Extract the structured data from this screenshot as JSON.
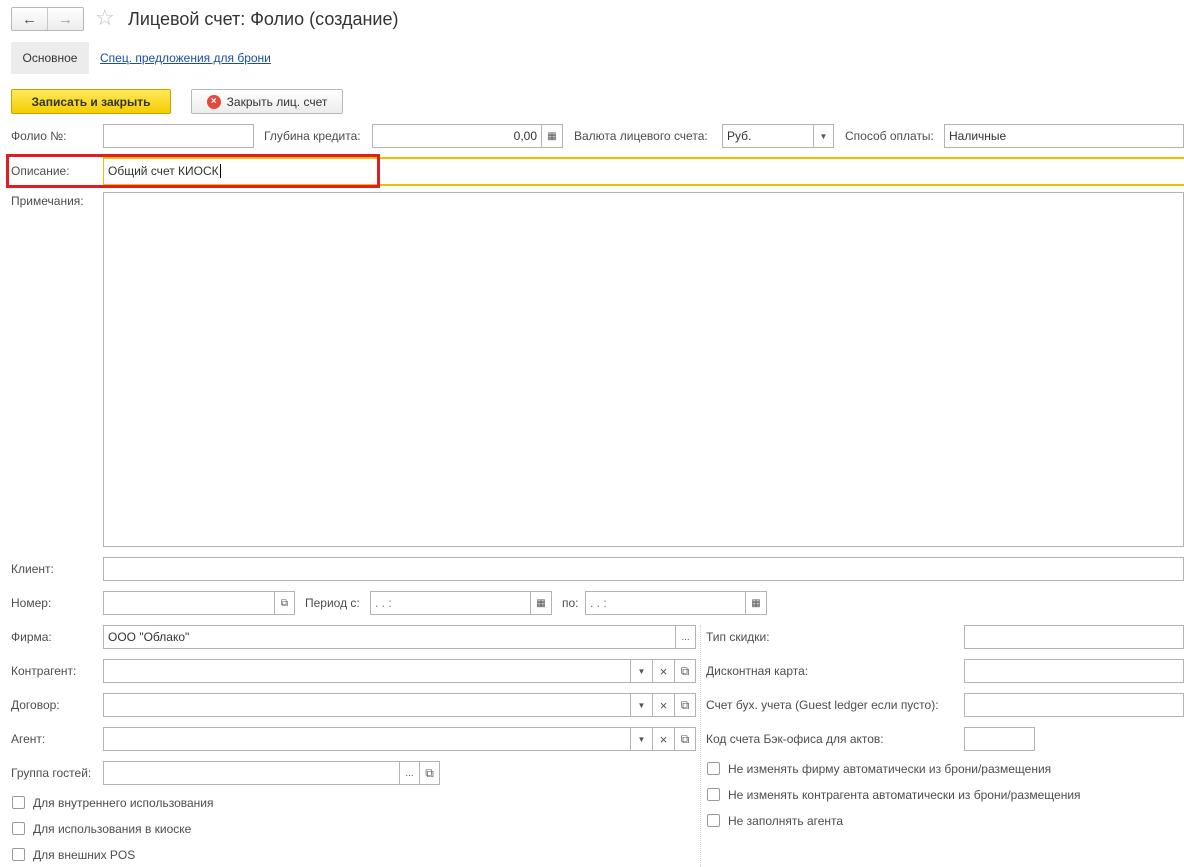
{
  "header": {
    "back_icon": "←",
    "forward_icon": "→",
    "star_icon": "☆",
    "title": "Лицевой счет: Фолио (создание)"
  },
  "tabs": {
    "main": "Основное",
    "special": "Спец. предложения для брони"
  },
  "toolbar": {
    "save_label": "Записать и закрыть",
    "close_label": "Закрыть лиц. счет",
    "close_icon": "×"
  },
  "form": {
    "folio_label": "Фолио №:",
    "folio_value": "",
    "credit_label": "Глубина кредита:",
    "credit_value": "0,00",
    "currency_label": "Валюта лицевого счета:",
    "currency_value": "Руб.",
    "payment_label": "Способ оплаты:",
    "payment_value": "Наличные",
    "description_label": "Описание:",
    "description_value": "Общий счет КИОСК",
    "notes_label": "Примечания:",
    "client_label": "Клиент:",
    "number_label": "Номер:",
    "period_from_label": "Период с:",
    "period_from_value": " .  .     :",
    "period_to_label": "по:",
    "period_to_value": " .  .     :",
    "firm_label": "Фирма:",
    "firm_value": "ООО \"Облако\"",
    "counterparty_label": "Контрагент:",
    "contract_label": "Договор:",
    "agent_label": "Агент:",
    "guest_group_label": "Группа гостей:",
    "discount_type_label": "Тип скидки:",
    "discount_card_label": "Дисконтная карта:",
    "ledger_label": "Счет бух. учета (Guest ledger если пусто):",
    "backoffice_label": "Код счета Бэк-офиса для актов:",
    "ellipsis": "...",
    "dropdown_glyph": "▼",
    "clear_glyph": "×",
    "open_glyph": "⧉",
    "calendar_glyph": "▦"
  },
  "checkboxes": {
    "internal": "Для внутреннего использования",
    "kiosk": "Для использования в киоске",
    "external_pos": "Для внешних POS",
    "no_change_firm": "Не изменять фирму автоматически из брони/размещения",
    "no_change_counterparty": "Не изменять контрагента автоматически из брони/размещения",
    "no_fill_agent": "Не заполнять агента"
  }
}
